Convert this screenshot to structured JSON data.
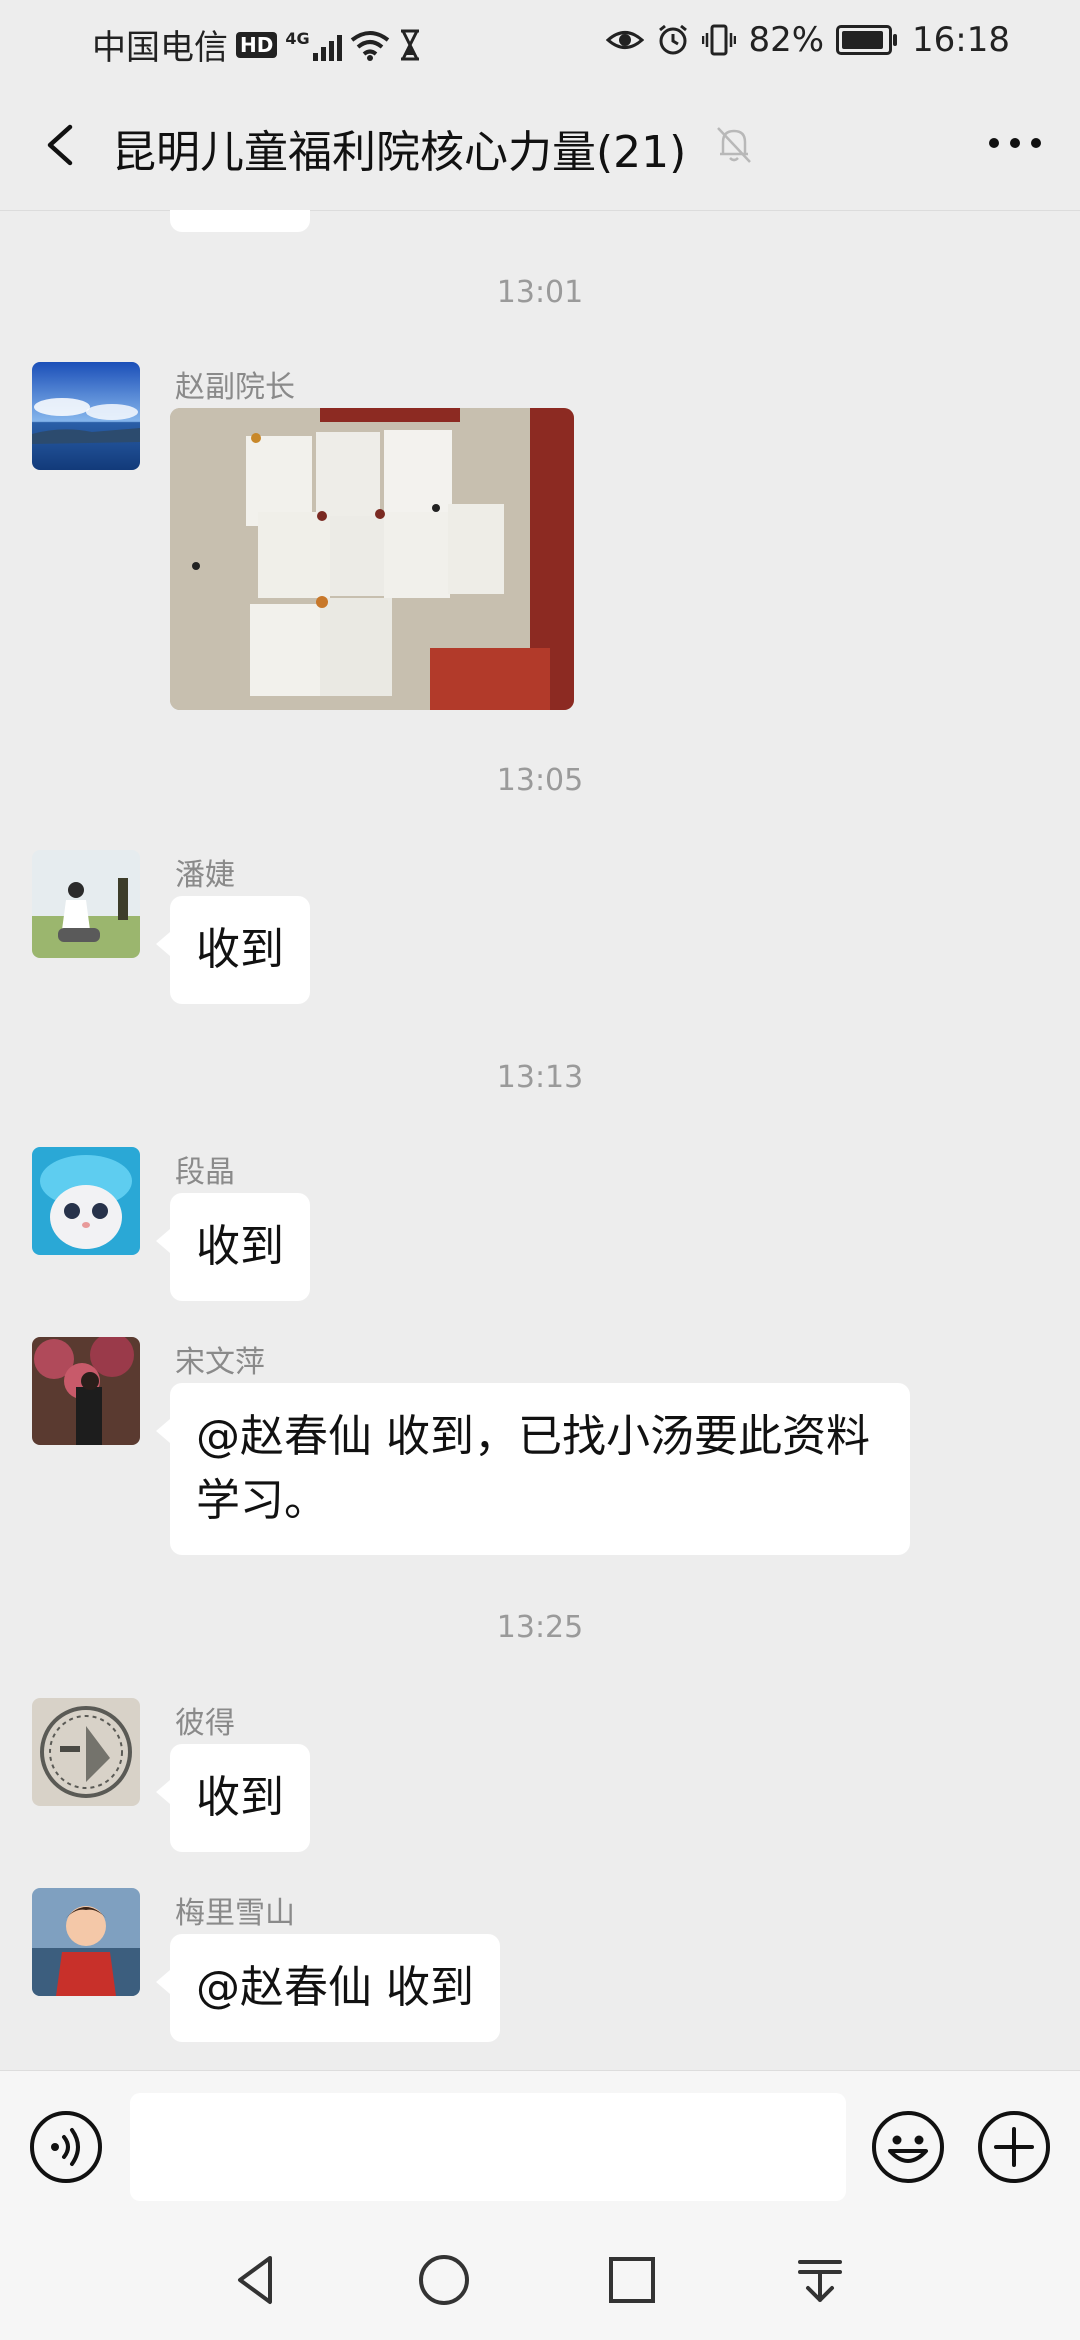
{
  "status_bar": {
    "carrier": "中国电信",
    "hd_badge": "HD",
    "network": "4G",
    "battery_percent": "82%",
    "battery_level": 0.82,
    "time": "16:18"
  },
  "header": {
    "title": "昆明儿童福利院核心力量(21)",
    "icons": [
      "back-arrow-icon",
      "bell-muted-icon",
      "more-dots-icon"
    ]
  },
  "messages": [
    {
      "type": "time",
      "text": "13:01"
    },
    {
      "type": "image",
      "sender": "赵副院长",
      "avatar": "landscape-lake"
    },
    {
      "type": "time",
      "text": "13:05"
    },
    {
      "type": "text",
      "sender": "潘婕",
      "text": "收到"
    },
    {
      "type": "time",
      "text": "13:13"
    },
    {
      "type": "text",
      "sender": "段晶",
      "text": "收到"
    },
    {
      "type": "text",
      "sender": "宋文萍",
      "text_line1": "@赵春仙  收到，已找小汤要此资料",
      "text_line2": "学习。"
    },
    {
      "type": "time",
      "text": "13:25"
    },
    {
      "type": "text",
      "sender": "彼得",
      "text": "收到"
    },
    {
      "type": "text",
      "sender": "梅里雪山",
      "text": "@赵春仙  收到"
    }
  ],
  "input_bar": {
    "placeholder": "",
    "icons": [
      "voice-icon",
      "emoji-icon",
      "plus-icon"
    ]
  },
  "nav_bar": {
    "icons": [
      "nav-back-icon",
      "nav-home-icon",
      "nav-recents-icon",
      "nav-notification-icon"
    ]
  }
}
